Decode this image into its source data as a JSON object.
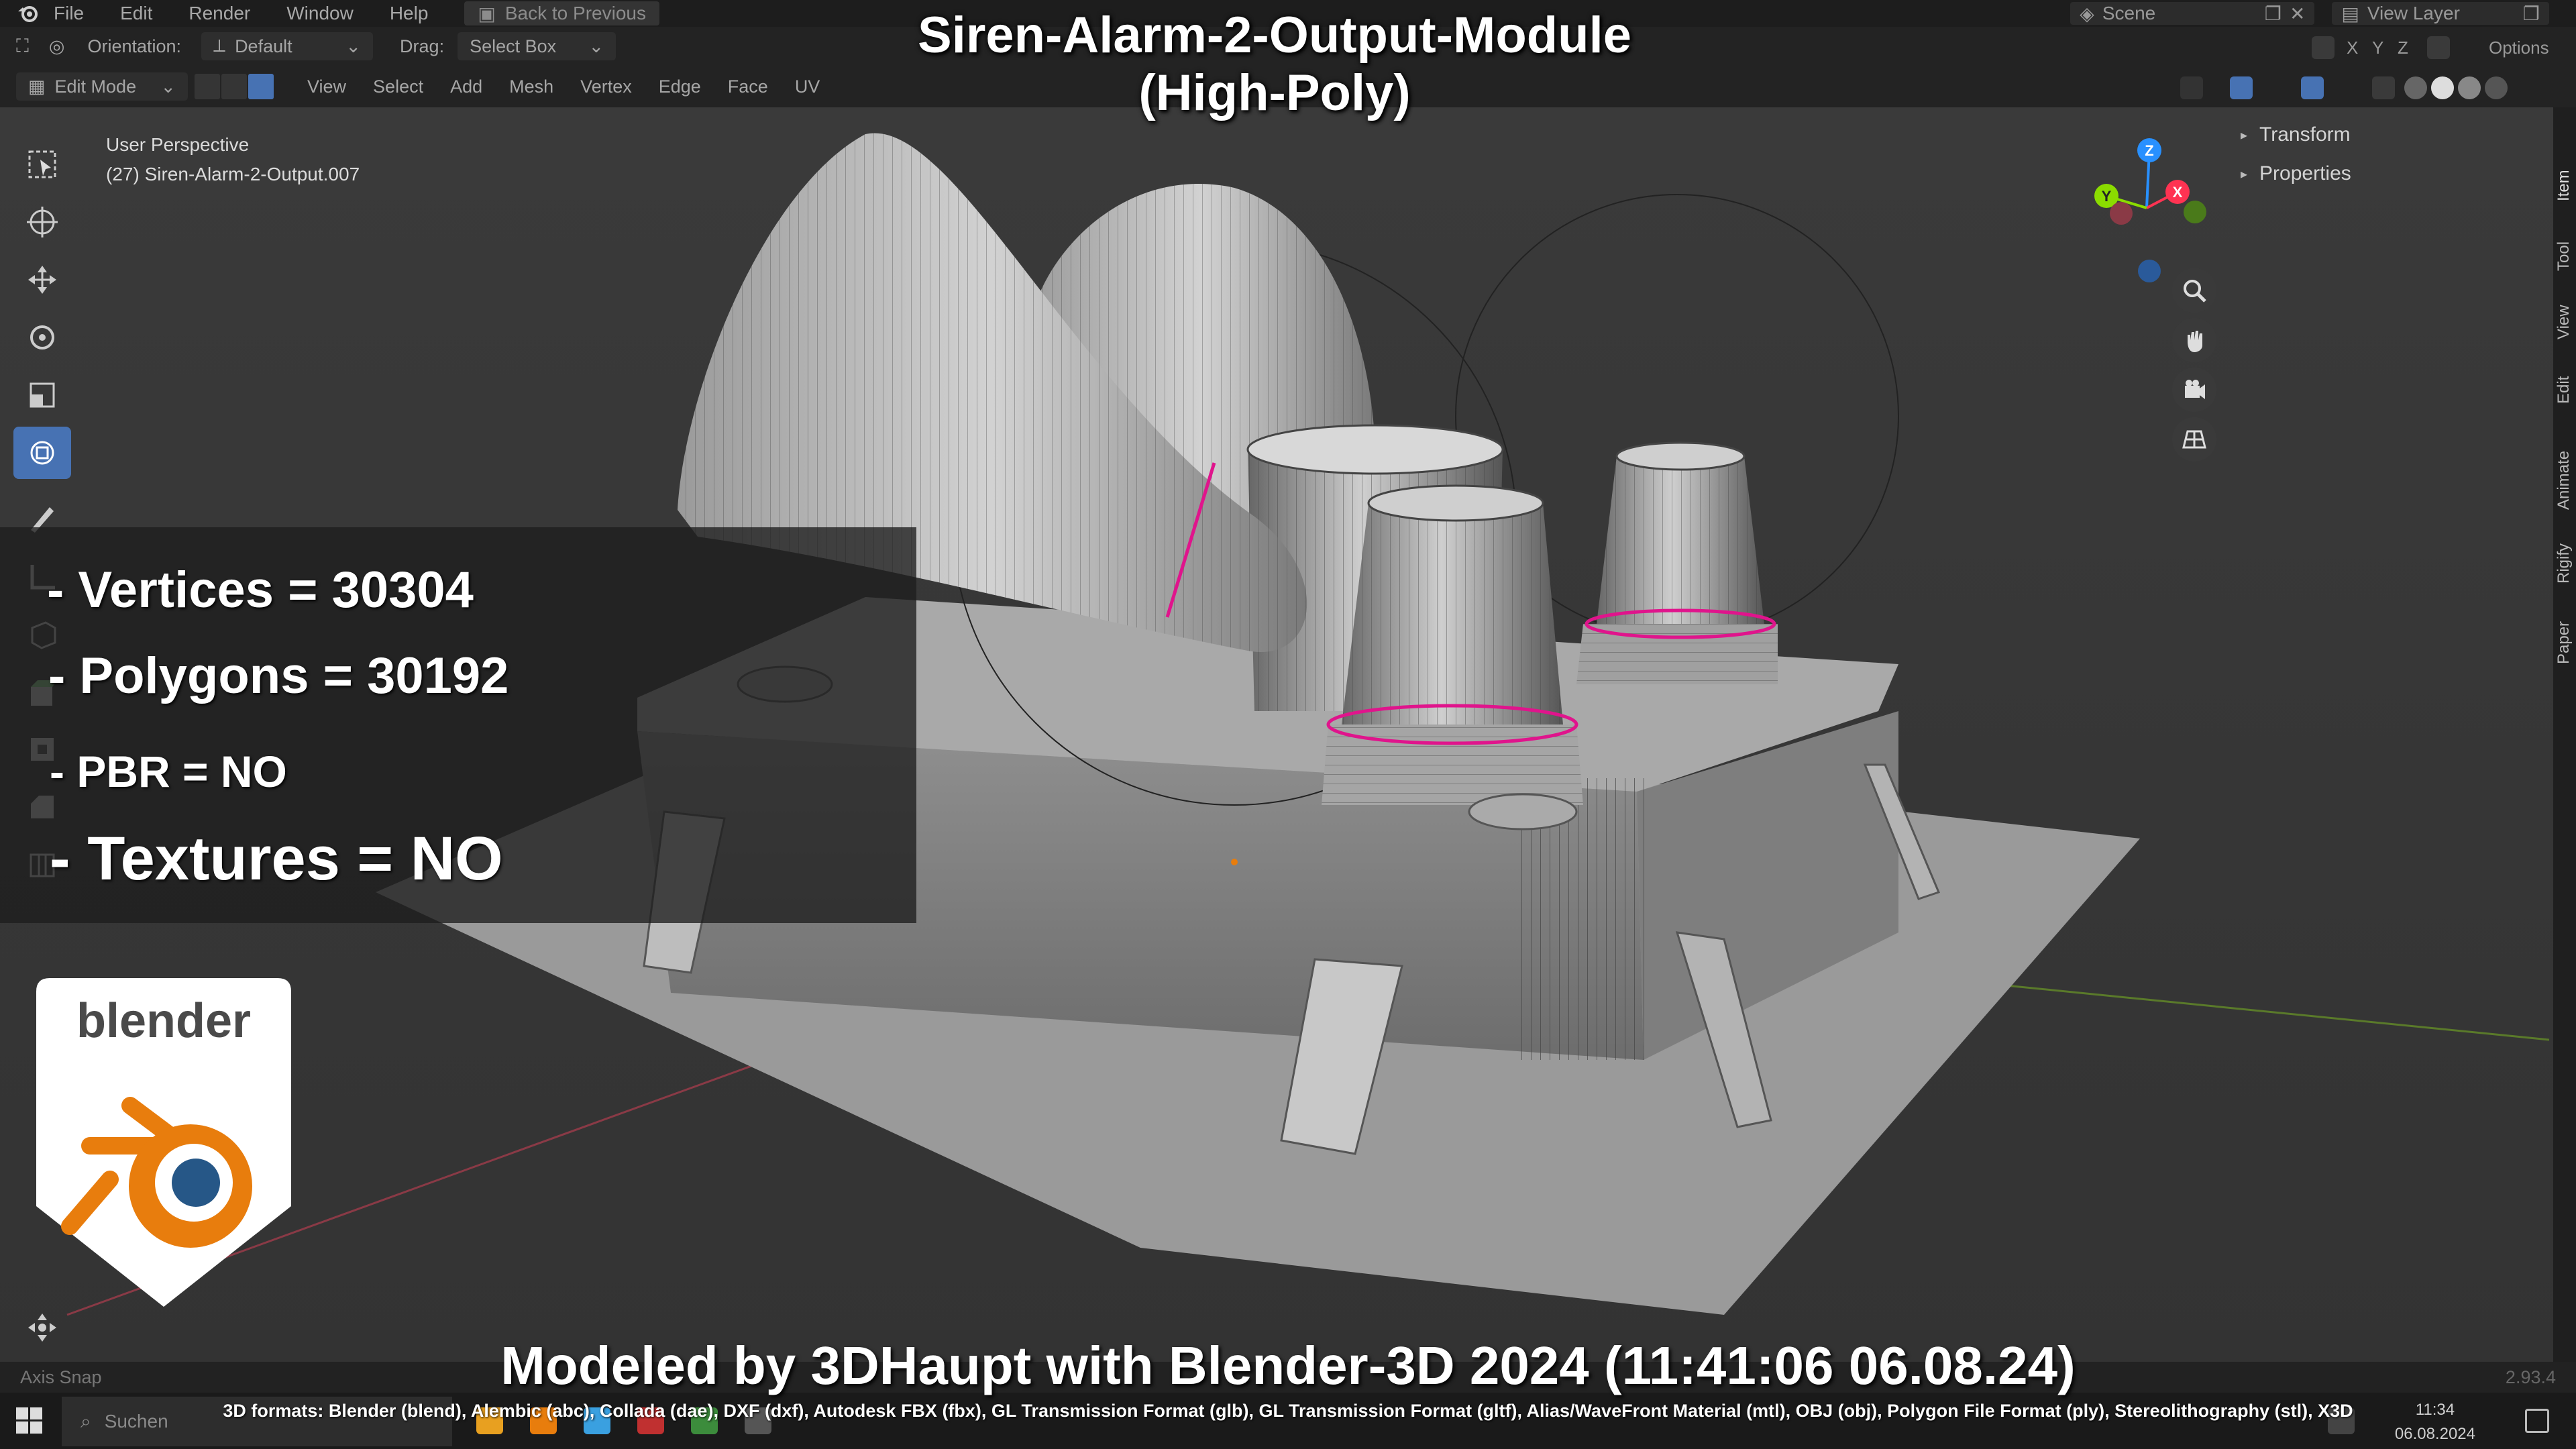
{
  "menubar": {
    "items": [
      "File",
      "Edit",
      "Render",
      "Window",
      "Help"
    ],
    "back_label": "Back to Previous",
    "scene_label": "Scene",
    "view_layer_label": "View Layer"
  },
  "header": {
    "orientation_label": "Orientation:",
    "orientation_value": "Default",
    "drag_label": "Drag:",
    "drag_value": "Select Box",
    "mode_value": "Edit Mode",
    "menus": [
      "View",
      "Select",
      "Add",
      "Mesh",
      "Vertex",
      "Edge",
      "Face",
      "UV"
    ],
    "options_label": "Options",
    "axis_x": "X",
    "axis_y": "Y",
    "axis_z": "Z"
  },
  "viewport": {
    "perspective": "User Perspective",
    "object_name": "(27) Siren-Alarm-2-Output.007"
  },
  "npanel": {
    "items": [
      "Transform",
      "Properties"
    ],
    "tabs": [
      "Item",
      "Tool",
      "View",
      "Edit",
      "Animate",
      "Rigify",
      "Paper"
    ]
  },
  "overlay": {
    "title_line1": "Siren-Alarm-2-Output-Module",
    "title_line2": "(High-Poly)",
    "stats": {
      "vertices": "- Vertices = 30304",
      "polygons": "- Polygons = 30192",
      "pbr": "- PBR =  NO",
      "textures": "- Textures = NO"
    },
    "logo_text": "blender",
    "credit": "Modeled by 3DHaupt with Blender-3D 2024 (11:41:06  06.08.24)",
    "formats": "3D formats: Blender (blend), Alembic (abc), Collada (dae), DXF (dxf), Autodesk FBX (fbx), GL Transmission Format (glb), GL Transmission Format (gltf), Alias/WaveFront Material (mtl), OBJ (obj), Polygon File Format (ply), Stereolithography (stl), X3D"
  },
  "statusbar": {
    "snap": "Axis Snap",
    "version": "2.93.4"
  },
  "taskbar": {
    "search_placeholder": "Suchen",
    "time": "11:34",
    "date": "06.08.2024"
  },
  "colors": {
    "accent": "#4772b3",
    "blender_orange": "#e87d0d",
    "blender_blue": "#265787",
    "axis_red": "#ff3352",
    "axis_green": "#8bdc00",
    "axis_blue": "#2890ff",
    "seam_magenta": "#e0148c"
  }
}
